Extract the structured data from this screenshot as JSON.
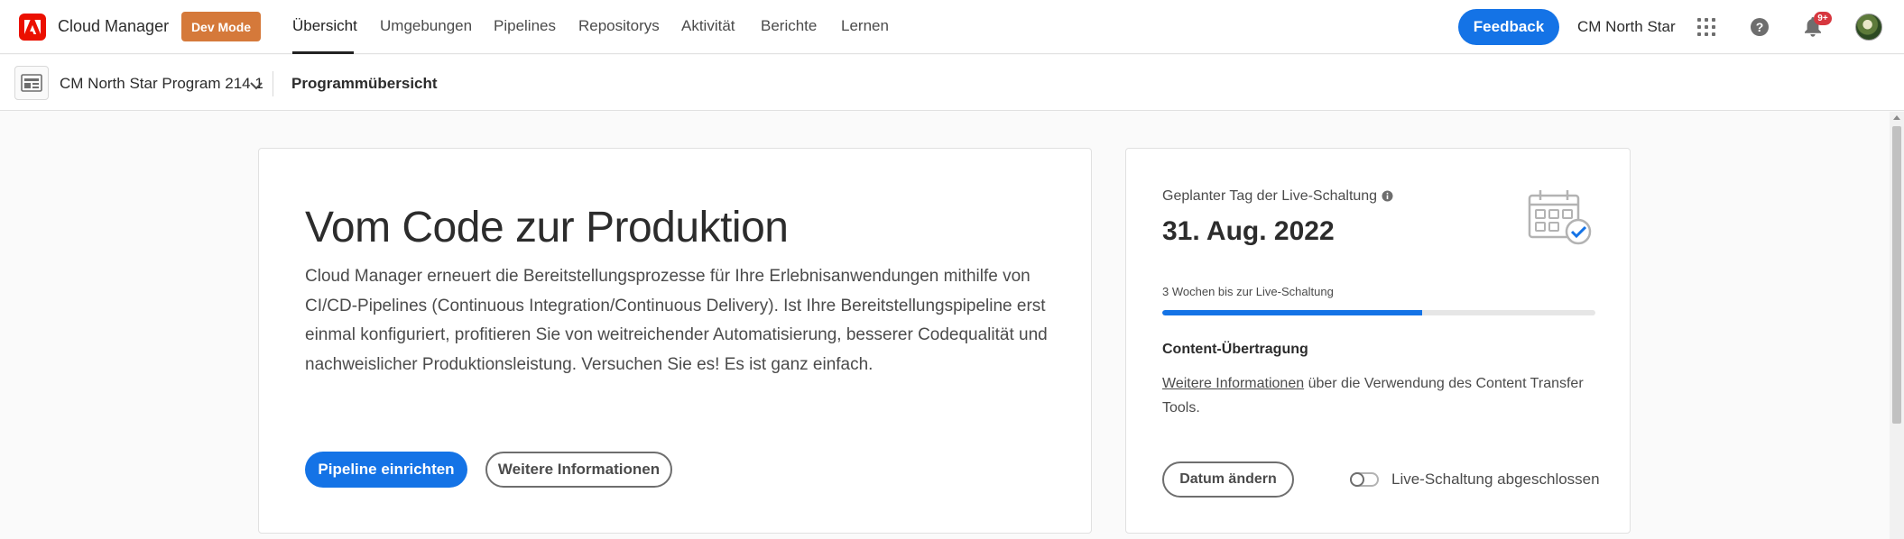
{
  "app": {
    "title": "Cloud Manager",
    "dev_mode": "Dev Mode",
    "brand_color": "#eb1000",
    "accent_color": "#1473e6",
    "dev_mode_color": "#d5793a"
  },
  "nav": {
    "tabs": [
      {
        "label": "Übersicht",
        "active": true
      },
      {
        "label": "Umgebungen"
      },
      {
        "label": "Pipelines"
      },
      {
        "label": "Repositorys"
      },
      {
        "label": "Aktivität"
      },
      {
        "label": "Berichte"
      },
      {
        "label": "Lernen"
      }
    ]
  },
  "header": {
    "feedback": "Feedback",
    "org_name": "CM North Star",
    "notification_badge": "9+",
    "icons": [
      "app-switcher-icon",
      "help-icon",
      "bell-icon",
      "avatar"
    ]
  },
  "subbar": {
    "program_name": "CM North Star Program 214 1",
    "page_title": "Programmübersicht"
  },
  "hero": {
    "title": "Vom Code zur Produktion",
    "description": "Cloud Manager erneuert die Bereitstellungsprozesse für Ihre Erlebnisanwendungen mithilfe von CI/CD-Pipelines (Continuous Integration/Continuous Delivery). Ist Ihre Bereitstellungspipeline erst einmal konfiguriert, profitieren Sie von weitreichender Automatisierung, besserer Codequalität und nachweislicher Produktionsleistung. Versuchen Sie es! Es ist ganz einfach.",
    "primary_button": "Pipeline einrichten",
    "secondary_button": "Weitere Informationen"
  },
  "golive": {
    "label": "Geplanter Tag der Live-Schaltung",
    "date": "31. Aug. 2022",
    "weeks_label": "3 Wochen bis zur Live-Schaltung",
    "progress_fraction": 0.6,
    "content_transfer_heading": "Content-Übertragung",
    "content_transfer_link": "Weitere Informationen",
    "content_transfer_text": " über die Verwendung des Content Transfer Tools.",
    "change_date_button": "Datum ändern",
    "toggle_label": "Live-Schaltung abgeschlossen",
    "toggle_on": false
  }
}
